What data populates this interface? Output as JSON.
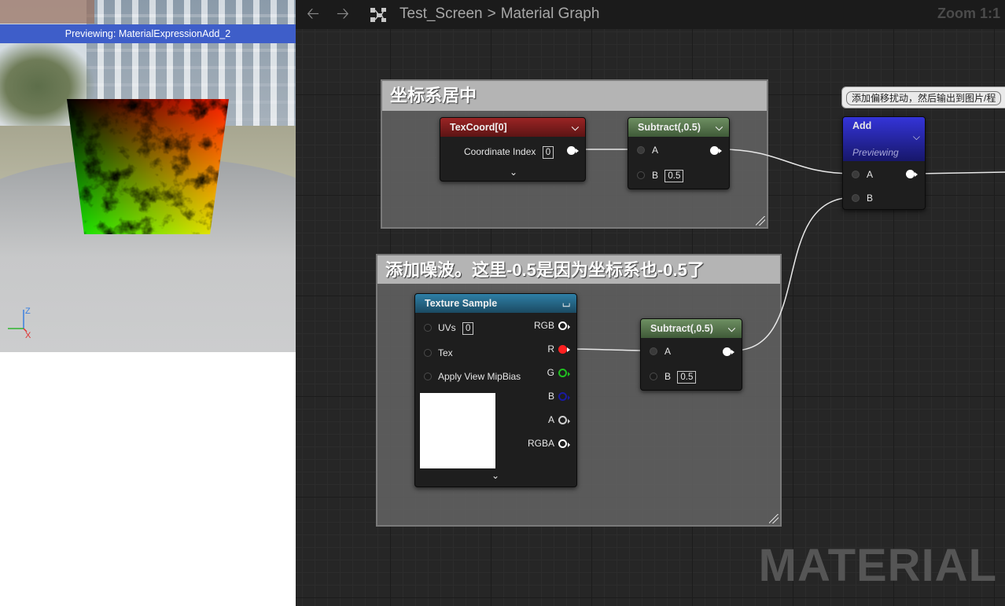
{
  "preview": {
    "status": "Previewing: MaterialExpressionAdd_2",
    "axis_labels": {
      "z": "Z",
      "x": "X"
    }
  },
  "toolbar": {
    "back_icon": "arrow-left-icon",
    "forward_icon": "arrow-right-icon",
    "graph_icon": "material-graph-icon",
    "breadcrumb": [
      "Test_Screen",
      "Material Graph"
    ],
    "breadcrumb_separator": ">",
    "zoom": "Zoom 1:1"
  },
  "comments": [
    {
      "title": "坐标系居中"
    },
    {
      "title": "添加噪波。这里-0.5是因为坐标系也-0.5了"
    }
  ],
  "nodes": {
    "texcoord": {
      "title": "TexCoord[0]",
      "color": "#8e1f1f",
      "param_label": "Coordinate Index",
      "param_value": "0"
    },
    "subtract1": {
      "title": "Subtract(,0.5)",
      "color": "#5a7a4f",
      "pin_a": "A",
      "pin_b": "B",
      "b_value": "0.5"
    },
    "add": {
      "title": "Add",
      "subtitle": "Previewing",
      "color": "#2b2bb8",
      "pin_a": "A",
      "pin_b": "B"
    },
    "texture_sample": {
      "title": "Texture Sample",
      "color": "#2a6a8a",
      "inputs": [
        {
          "label": "UVs",
          "value": "0"
        },
        {
          "label": "Tex",
          "value": ""
        },
        {
          "label": "Apply View MipBias",
          "value": ""
        }
      ],
      "outputs": [
        {
          "label": "RGB",
          "color": "#ffffff"
        },
        {
          "label": "R",
          "color": "#ff2020"
        },
        {
          "label": "G",
          "color": "#20c020"
        },
        {
          "label": "B",
          "color": "#1a1aa0"
        },
        {
          "label": "A",
          "color": "#cfcfcf"
        },
        {
          "label": "RGBA",
          "color": "#ffffff"
        }
      ]
    },
    "subtract2": {
      "title": "Subtract(,0.5)",
      "color": "#5a7a4f",
      "pin_a": "A",
      "pin_b": "B",
      "b_value": "0.5"
    }
  },
  "tooltip": {
    "text": "添加偏移扰动，然后输出到图片/程"
  },
  "watermark": "MATERIAL"
}
